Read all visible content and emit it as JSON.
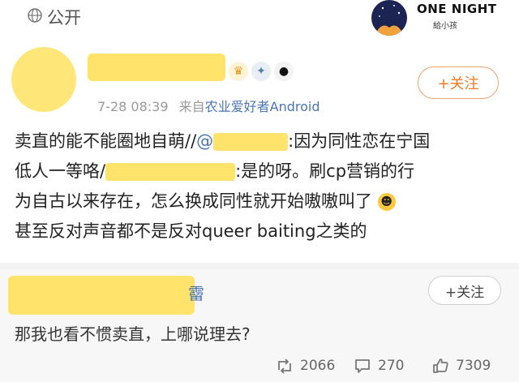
{
  "topbar": {
    "visibility": "公开"
  },
  "brand": {
    "line1": "ONE NIGHT",
    "line2": "給小孩"
  },
  "post": {
    "follow_label": "+关注",
    "time": "7-28 08:39",
    "source_prefix": "来自",
    "source": "农业爱好者Android",
    "text": {
      "l1_a": "卖直的能不能圈地自萌//",
      "l1_mention": "@",
      "l1_b": ":因为同性恋在宁国",
      "l2_a": "低人一等咯/",
      "l2_b": ":是的呀。刷cp营销的行",
      "l3": "为自古以来存在，怎么换成同性就开始嗷嗷叫了",
      "l4": "甚至反对声音都不是反对queer baiting之类的"
    }
  },
  "repost": {
    "name_tail": "霤",
    "follow_label": "+关注",
    "text": "那我也看不惯卖直，上哪说理去?"
  },
  "actions": {
    "reposts": "2066",
    "comments": "270",
    "likes": "7309"
  },
  "colors": {
    "accent": "#f07a26",
    "link": "#4a76b2",
    "scribble": "#ffe36a"
  }
}
